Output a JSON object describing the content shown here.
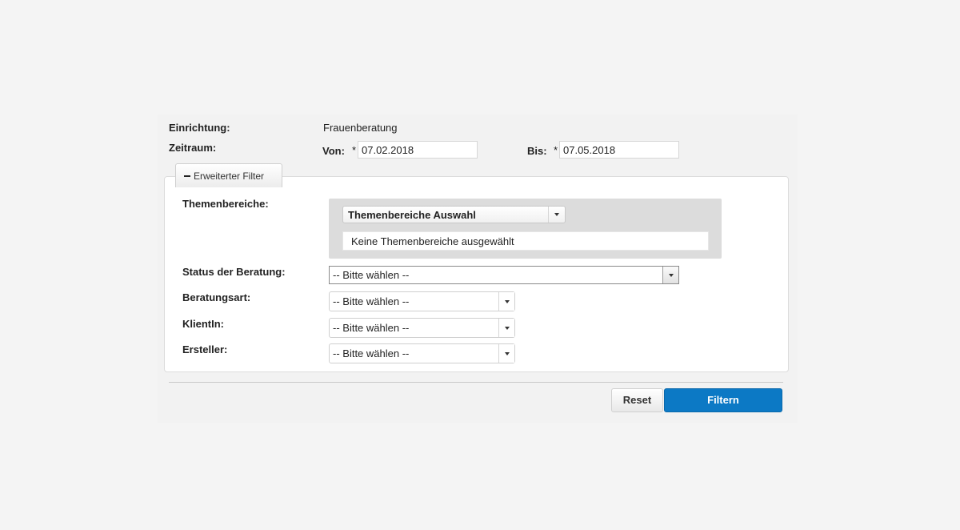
{
  "header": {
    "facility_label": "Einrichtung:",
    "facility_value": "Frauenberatung",
    "period_label": "Zeitraum:",
    "from_label": "Von:",
    "to_label": "Bis:",
    "required_marker": "*",
    "from_value": "07.02.2018",
    "to_value": "07.05.2018"
  },
  "advanced_filter": {
    "toggle_label": "Erweiterter Filter",
    "topics": {
      "label": "Themenbereiche:",
      "select_label": "Themenbereiche Auswahl",
      "empty_text": "Keine Themenbereiche ausgewählt"
    },
    "status": {
      "label": "Status der Beratung:",
      "value": "-- Bitte wählen --"
    },
    "type": {
      "label": "Beratungsart:",
      "value": "-- Bitte wählen --"
    },
    "client": {
      "label": "KlientIn:",
      "value": "-- Bitte wählen --"
    },
    "creator": {
      "label": "Ersteller:",
      "value": "-- Bitte wählen --"
    }
  },
  "actions": {
    "reset_label": "Reset",
    "filter_label": "Filtern"
  },
  "colors": {
    "primary": "#0c79c5",
    "background": "#f4f4f4"
  }
}
